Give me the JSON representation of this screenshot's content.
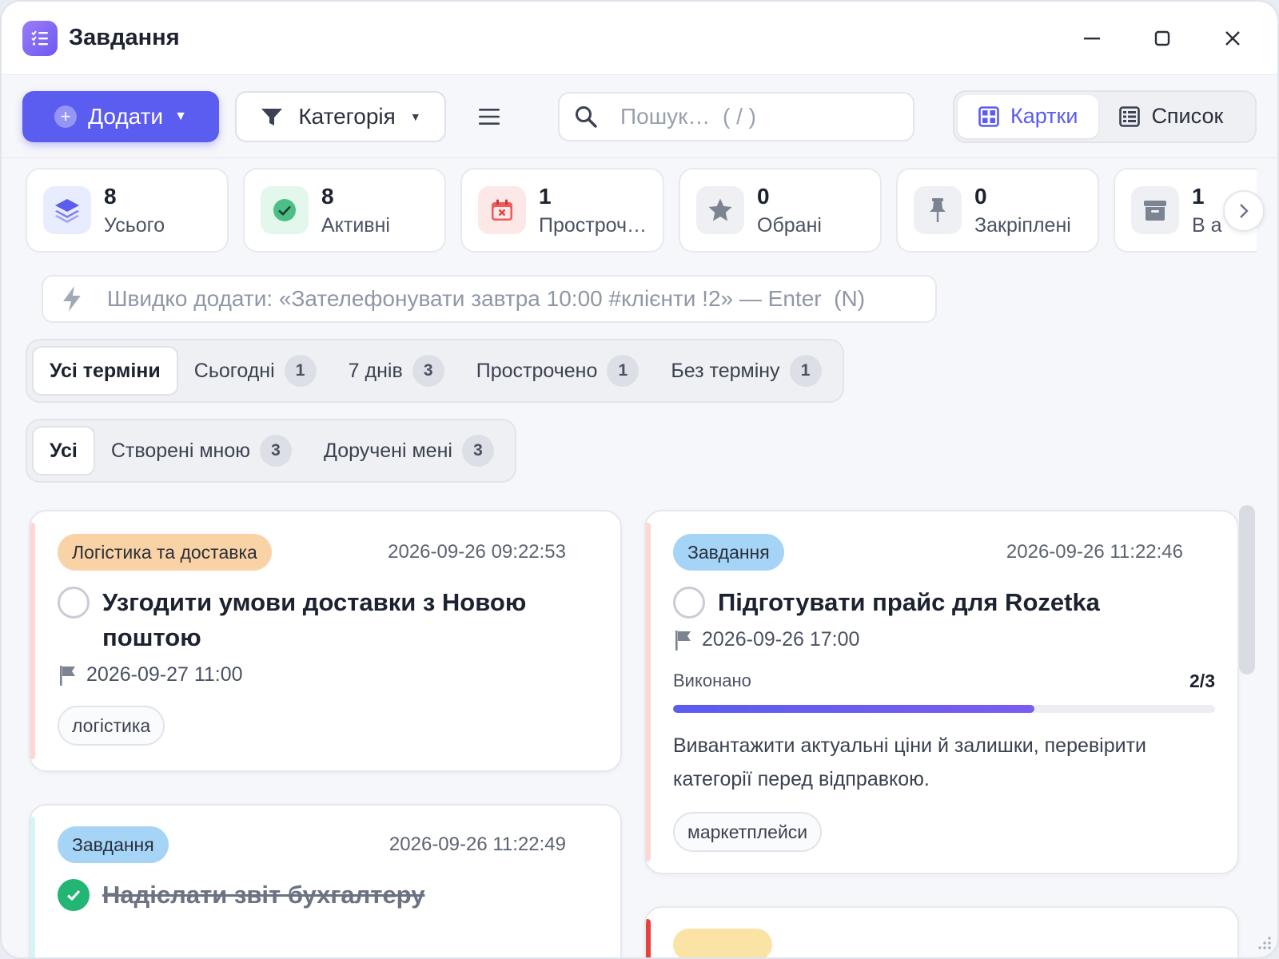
{
  "window": {
    "title": "Завдання"
  },
  "toolbar": {
    "add_label": "Додати",
    "category_label": "Категорія",
    "search_placeholder": "Пошук…  ( / )",
    "views": [
      {
        "label": "Картки",
        "active": true
      },
      {
        "label": "Список",
        "active": false
      }
    ]
  },
  "stats": [
    {
      "value": "8",
      "label": "Усього",
      "icon": "layers-icon"
    },
    {
      "value": "8",
      "label": "Активні",
      "icon": "check-circle-icon"
    },
    {
      "value": "1",
      "label": "Простроч…",
      "icon": "calendar-x-icon"
    },
    {
      "value": "0",
      "label": "Обрані",
      "icon": "star-icon"
    },
    {
      "value": "0",
      "label": "Закріплені",
      "icon": "pin-icon"
    },
    {
      "value": "1",
      "label": "В а",
      "icon": "archive-icon"
    }
  ],
  "quick_add": {
    "placeholder": "Швидко додати: «Зателефонувати завтра 10:00 #клієнти !2» — Enter  (N)"
  },
  "due_filters": [
    {
      "label": "Усі терміни",
      "count": null,
      "active": true
    },
    {
      "label": "Сьогодні",
      "count": "1",
      "active": false
    },
    {
      "label": "7 днів",
      "count": "3",
      "active": false
    },
    {
      "label": "Прострочено",
      "count": "1",
      "active": false
    },
    {
      "label": "Без терміну",
      "count": "1",
      "active": false
    }
  ],
  "owner_filters": [
    {
      "label": "Усі",
      "count": null,
      "active": true
    },
    {
      "label": "Створені мною",
      "count": "3",
      "active": false
    },
    {
      "label": "Доручені мені",
      "count": "3",
      "active": false
    }
  ],
  "cards": [
    {
      "category": "Логістика та доставка",
      "category_color": "#f9d3a5",
      "accent": "#ffd6d0",
      "created": "2026-09-26 09:22:53",
      "title": "Узгодити умови доставки з Новою поштою",
      "done": false,
      "due": "2026-09-27 11:00",
      "tags": [
        "логістика"
      ]
    },
    {
      "category": "Завдання",
      "category_color": "#a6d4f7",
      "accent": "#ffd6d0",
      "created": "2026-09-26 11:22:46",
      "title": "Підготувати прайс для Rozetka",
      "done": false,
      "due": "2026-09-26 17:00",
      "progress_label": "Виконано",
      "progress_text": "2/3",
      "progress": 0.6667,
      "description": "Вивантажити актуальні ціни й залишки, перевірити категорії перед відправкою.",
      "tags": [
        "маркетплейси"
      ]
    },
    {
      "category": "Завдання",
      "category_color": "#a6d4f7",
      "accent": "#d4f4f6",
      "created": "2026-09-26 11:22:49",
      "title": "Надіслати звіт бухгалтеру",
      "done": true
    }
  ]
}
